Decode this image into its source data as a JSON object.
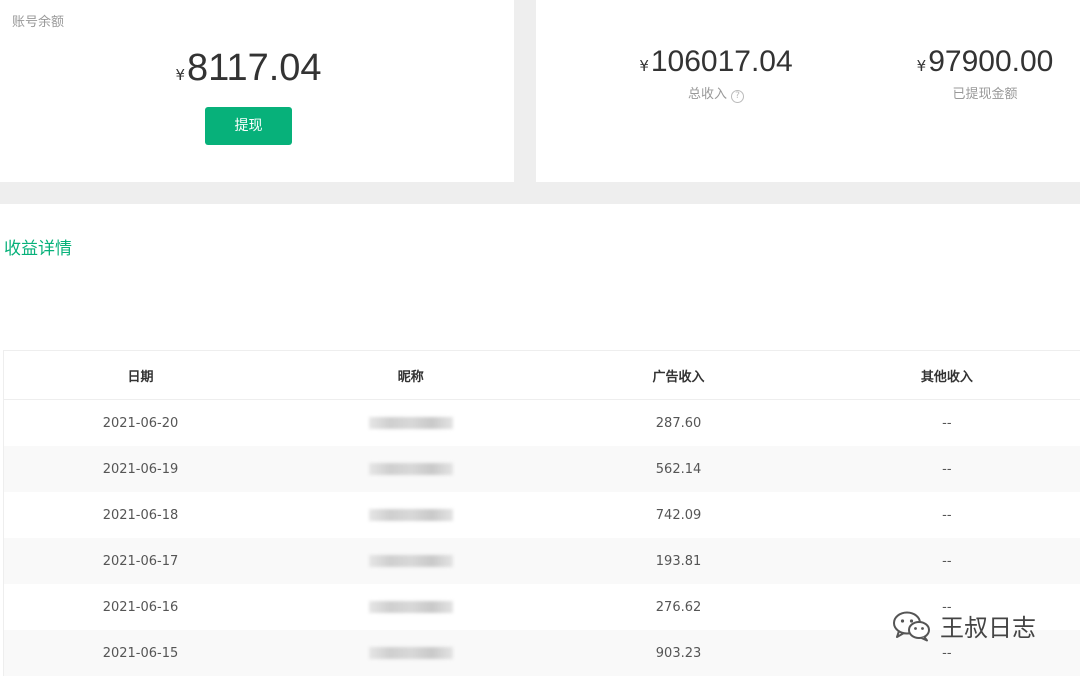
{
  "balance_card": {
    "label": "账号余额",
    "currency": "¥",
    "amount": "8117.04",
    "withdraw_button": "提现"
  },
  "income_card": {
    "total": {
      "currency": "¥",
      "amount": "106017.04",
      "caption": "总收入",
      "help_icon": "?"
    },
    "withdrawn": {
      "currency": "¥",
      "amount": "97900.00",
      "caption": "已提现金额"
    }
  },
  "earnings": {
    "title": "收益详情",
    "columns": [
      "日期",
      "昵称",
      "广告收入",
      "其他收入"
    ],
    "rows": [
      {
        "date": "2021-06-20",
        "ad_income": "287.60",
        "other_income": "--"
      },
      {
        "date": "2021-06-19",
        "ad_income": "562.14",
        "other_income": "--"
      },
      {
        "date": "2021-06-18",
        "ad_income": "742.09",
        "other_income": "--"
      },
      {
        "date": "2021-06-17",
        "ad_income": "193.81",
        "other_income": "--"
      },
      {
        "date": "2021-06-16",
        "ad_income": "276.62",
        "other_income": "--"
      },
      {
        "date": "2021-06-15",
        "ad_income": "903.23",
        "other_income": "--"
      }
    ]
  },
  "watermark": {
    "text": "王叔日志",
    "icon": "wechat-icon"
  },
  "colors": {
    "accent": "#07b17a",
    "page_background": "#eeeeee"
  }
}
